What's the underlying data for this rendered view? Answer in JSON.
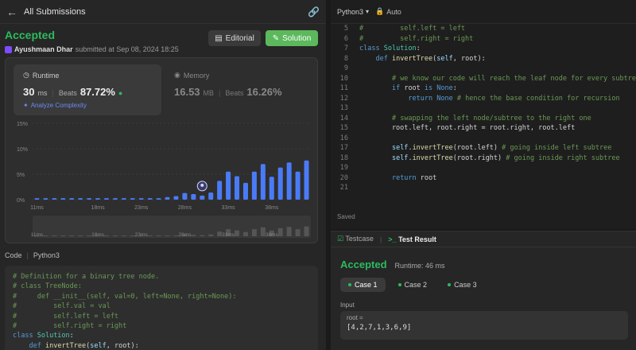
{
  "left": {
    "header": {
      "back_label": "All Submissions"
    },
    "status": "Accepted",
    "submitter": {
      "name": "Ayushmaan Dhar",
      "submitted_text": "submitted at Sep 08, 2024 18:25"
    },
    "buttons": {
      "editorial": "Editorial",
      "solution": "Solution"
    },
    "runtime": {
      "label": "Runtime",
      "value": "30",
      "unit": "ms",
      "beats_label": "Beats",
      "beats_pct": "87.72%",
      "analyze": "Analyze Complexity"
    },
    "memory": {
      "label": "Memory",
      "value": "16.53",
      "unit": "MB",
      "beats_label": "Beats",
      "beats_pct": "16.26%"
    },
    "code_tabs": {
      "code": "Code",
      "lang": "Python3"
    },
    "code_lines": [
      "# Definition for a binary tree node.",
      "# class TreeNode:",
      "#     def __init__(self, val=0, left=None, right=None):",
      "#         self.val = val",
      "#         self.left = left",
      "#         self.right = right",
      "class Solution:",
      "    def invertTree(self, root):"
    ]
  },
  "chart_data": {
    "type": "bar",
    "title": "",
    "xlabel": "",
    "ylabel": "",
    "y_ticks": [
      "15%",
      "10%",
      "5%",
      "0%"
    ],
    "ylim": [
      0,
      15
    ],
    "x_tick_labels": [
      "11ms",
      "18ms",
      "23ms",
      "28ms",
      "33ms",
      "38ms"
    ],
    "x_tick_values": [
      11,
      18,
      23,
      28,
      33,
      38
    ],
    "x": [
      11,
      12,
      13,
      14,
      15,
      16,
      17,
      18,
      19,
      20,
      21,
      22,
      23,
      24,
      25,
      26,
      27,
      28,
      29,
      30,
      31,
      32,
      33,
      34,
      35,
      36,
      37,
      38,
      39,
      40,
      41,
      42
    ],
    "values": [
      0.3,
      0.3,
      0.3,
      0.3,
      0.3,
      0.3,
      0.3,
      0.3,
      0.3,
      0.3,
      0.3,
      0.3,
      0.3,
      0.3,
      0.3,
      0.5,
      0.7,
      1.3,
      1.1,
      0.8,
      1.4,
      3.7,
      5.5,
      4.6,
      3.3,
      5.5,
      7.0,
      4.5,
      6.3,
      7.3,
      5.5,
      7.7
    ],
    "highlight_x": 30,
    "grid": true
  },
  "editor": {
    "lang": "Python3",
    "auto": "Auto",
    "saved": "Saved",
    "lines": [
      {
        "n": "5",
        "t": "#         self.left = left"
      },
      {
        "n": "6",
        "t": "#         self.right = right"
      },
      {
        "n": "7",
        "t": "class Solution:"
      },
      {
        "n": "8",
        "t": "    def invertTree(self, root):"
      },
      {
        "n": "9",
        "t": ""
      },
      {
        "n": "10",
        "t": "        # we know our code will reach the leaf node for every subtree"
      },
      {
        "n": "11",
        "t": "        if root is None:"
      },
      {
        "n": "12",
        "t": "            return None # hence the base condition for recursion"
      },
      {
        "n": "13",
        "t": ""
      },
      {
        "n": "14",
        "t": "        # swapping the left node/subtree to the right one"
      },
      {
        "n": "15",
        "t": "        root.left, root.right = root.right, root.left"
      },
      {
        "n": "16",
        "t": ""
      },
      {
        "n": "17",
        "t": "        self.invertTree(root.left) # going inside left subtree"
      },
      {
        "n": "18",
        "t": "        self.invertTree(root.right) # going inside right subtree"
      },
      {
        "n": "19",
        "t": ""
      },
      {
        "n": "20",
        "t": "        return root"
      },
      {
        "n": "21",
        "t": ""
      }
    ]
  },
  "result": {
    "tabs": {
      "testcase": "Testcase",
      "test_result": "Test Result"
    },
    "status": "Accepted",
    "runtime": "Runtime: 46 ms",
    "cases": [
      "Case 1",
      "Case 2",
      "Case 3"
    ],
    "input_label": "Input",
    "input_name": "root =",
    "input_value": "[4,2,7,1,3,6,9]"
  },
  "colors": {
    "accent_green": "#2cbb5d",
    "bar_blue": "#4a7bf7",
    "link_blue": "#6b8af5"
  }
}
